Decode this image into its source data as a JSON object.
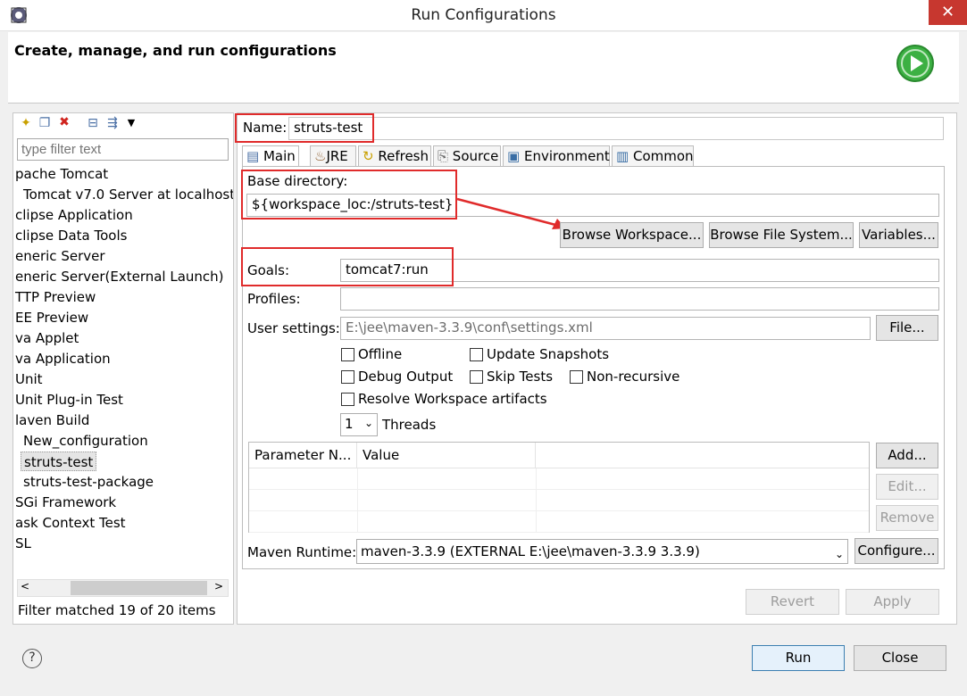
{
  "window": {
    "title": "Run Configurations",
    "close_glyph": "✕"
  },
  "header": {
    "title": "Create, manage, and run configurations"
  },
  "left": {
    "filter_placeholder": "type filter text",
    "items": [
      {
        "label": "pache Tomcat"
      },
      {
        "label": "Tomcat v7.0 Server at localhost"
      },
      {
        "label": "clipse Application"
      },
      {
        "label": "clipse Data Tools"
      },
      {
        "label": "eneric Server"
      },
      {
        "label": "eneric Server(External Launch)"
      },
      {
        "label": "TTP Preview"
      },
      {
        "label": "EE Preview"
      },
      {
        "label": "va Applet"
      },
      {
        "label": "va Application"
      },
      {
        "label": "Unit"
      },
      {
        "label": "Unit Plug-in Test"
      },
      {
        "label": "laven Build"
      },
      {
        "label": "New_configuration"
      },
      {
        "label": "struts-test"
      },
      {
        "label": "struts-test-package"
      },
      {
        "label": "SGi Framework"
      },
      {
        "label": "ask Context Test"
      },
      {
        "label": "SL"
      }
    ],
    "status": "Filter matched 19 of 20 items"
  },
  "config": {
    "name_label": "Name:",
    "name_value": "struts-test",
    "tabs": [
      "Main",
      "JRE",
      "Refresh",
      "Source",
      "Environment",
      "Common"
    ],
    "base_dir_label": "Base directory:",
    "base_dir_value": "${workspace_loc:/struts-test}",
    "browse_workspace": "Browse Workspace...",
    "browse_fs": "Browse File System...",
    "variables": "Variables...",
    "goals_label": "Goals:",
    "goals_value": "tomcat7:run",
    "profiles_label": "Profiles:",
    "profiles_value": "",
    "user_settings_label": "User settings:",
    "user_settings_value": "E:\\jee\\maven-3.3.9\\conf\\settings.xml",
    "file_button": "File...",
    "checkboxes": {
      "offline": "Offline",
      "update_snapshots": "Update Snapshots",
      "debug_output": "Debug Output",
      "skip_tests": "Skip Tests",
      "non_recursive": "Non-recursive",
      "resolve_workspace": "Resolve Workspace artifacts"
    },
    "threads_value": "1",
    "threads_label": "Threads",
    "table_headers": [
      "Parameter N...",
      "Value"
    ],
    "add": "Add...",
    "edit": "Edit...",
    "remove": "Remove",
    "maven_runtime_label": "Maven Runtime:",
    "maven_runtime_value": "maven-3.3.9 (EXTERNAL E:\\jee\\maven-3.3.9 3.3.9)",
    "configure": "Configure...",
    "revert": "Revert",
    "apply": "Apply"
  },
  "footer": {
    "run": "Run",
    "close": "Close",
    "help_glyph": "?"
  },
  "colors": {
    "annotation_red": "#e02b2b",
    "close_red": "#c7372f",
    "run_green": "#3cb043"
  }
}
